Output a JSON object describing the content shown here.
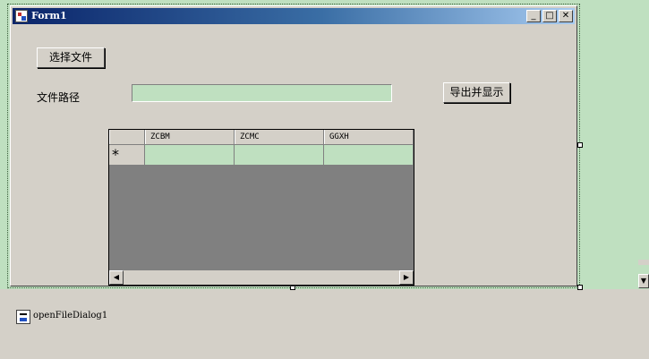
{
  "window": {
    "title": "Form1",
    "minimize_glyph": "_",
    "maximize_glyph": "□",
    "close_glyph": "✕"
  },
  "form": {
    "select_file_button": "选择文件",
    "file_path_label": "文件路径",
    "file_path_value": "",
    "export_button": "导出并显示"
  },
  "grid": {
    "columns": [
      "ZCBM",
      "ZCMC",
      "GGXH"
    ],
    "new_row_marker": "*",
    "scroll_left_glyph": "◀",
    "scroll_right_glyph": "▶"
  },
  "tray": {
    "component_name": "openFileDialog1"
  },
  "edge_scroll": {
    "down_glyph": "▼"
  },
  "colors": {
    "titlebar_start": "#0a246a",
    "titlebar_end": "#a6caf0",
    "control_face": "#d4d0c8",
    "input_bg": "#bfe0c0",
    "grid_bg": "#808080"
  }
}
